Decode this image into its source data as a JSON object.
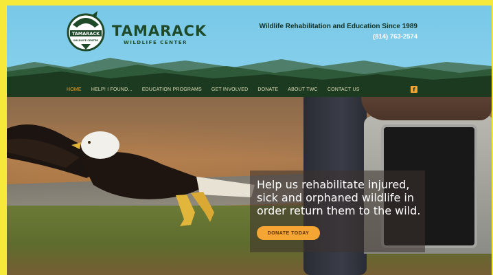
{
  "brand": {
    "logo_text": "TAMARACK",
    "logo_subtext": "WILDLIFE CENTER",
    "name": "TAMARACK",
    "subtitle": "WILDLIFE CENTER"
  },
  "header": {
    "tagline": "Wildlife Rehabilitation and Education Since 1989",
    "phone": "(814) 763-2574"
  },
  "nav": {
    "items": [
      {
        "label": "HOME",
        "active": true
      },
      {
        "label": "HELP! I FOUND...",
        "active": false
      },
      {
        "label": "EDUCATION PROGRAMS",
        "active": false
      },
      {
        "label": "GET INVOLVED",
        "active": false
      },
      {
        "label": "DONATE",
        "active": false
      },
      {
        "label": "ABOUT TWC",
        "active": false
      },
      {
        "label": "CONTACT US",
        "active": false
      }
    ],
    "social_icon": "facebook-icon",
    "social_glyph": "f"
  },
  "hero": {
    "caption": "Help us rehabilitate injured, sick and orphaned wildlife in order return them to the wild.",
    "button_label": "DONATE TODAY"
  },
  "colors": {
    "accent": "#f4a534",
    "nav_bg": "#1b3a20",
    "sky": "#7cc9e6",
    "brand_green": "#1f4a2a",
    "page_border": "#f7e93a"
  }
}
